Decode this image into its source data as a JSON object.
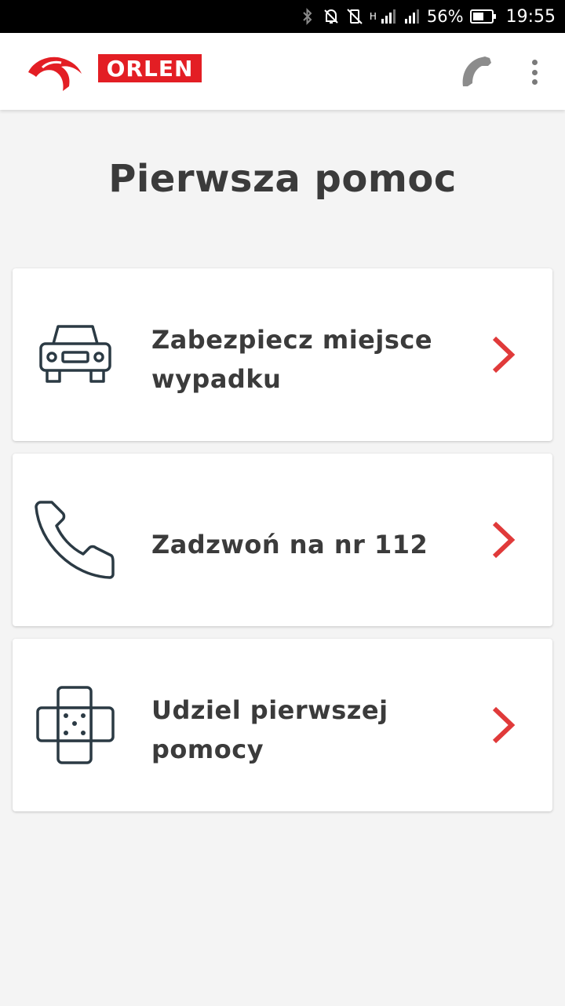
{
  "status_bar": {
    "network_label": "H",
    "battery_percent": "56%",
    "time": "19:55",
    "icons": [
      "bluetooth-icon",
      "mute-icon",
      "vibrate-off-icon",
      "signal-icon",
      "signal-icon",
      "battery-icon"
    ]
  },
  "app_bar": {
    "brand": "ORLEN",
    "brand_color": "#e31e24",
    "actions": [
      "phone-icon",
      "more-vert-icon"
    ]
  },
  "page": {
    "title": "Pierwsza pomoc"
  },
  "items": [
    {
      "label": "Zabezpiecz miejsce wypadku",
      "icon": "car-icon"
    },
    {
      "label": "Zadzwoń na nr 112",
      "icon": "phone-icon"
    },
    {
      "label": "Udziel pierwszej pomocy",
      "icon": "bandage-icon"
    }
  ],
  "accent_color": "#e03a3a"
}
